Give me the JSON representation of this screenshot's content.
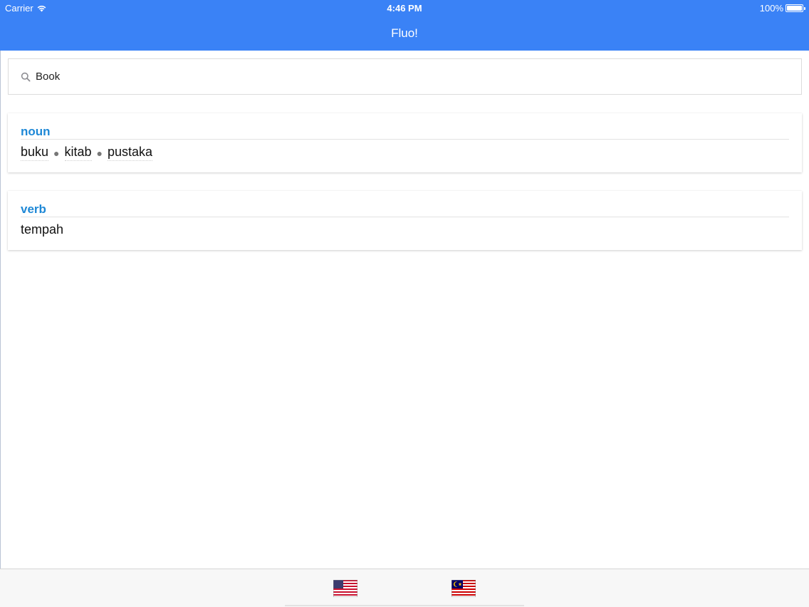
{
  "status": {
    "carrier": "Carrier",
    "time": "4:46 PM",
    "battery": "100%"
  },
  "nav": {
    "title": "Fluo!"
  },
  "search": {
    "value": "Book",
    "icon": "search-icon"
  },
  "results": [
    {
      "pos": "noun",
      "words": [
        "buku",
        "kitab",
        "pustaka"
      ]
    },
    {
      "pos": "verb",
      "words": [
        "tempah"
      ]
    }
  ],
  "bottom": {
    "flags": [
      "us-flag-icon",
      "malaysia-flag-icon"
    ]
  },
  "colors": {
    "nav_bg": "#3a82f6",
    "pos_label": "#1e88d6"
  }
}
